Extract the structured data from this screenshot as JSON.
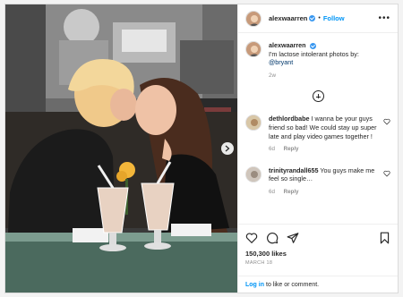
{
  "post": {
    "username": "alexwaarren",
    "follow_label": "Follow",
    "caption_text": "I'm lactose intolerant photos by:",
    "caption_mention": "@bryant",
    "caption_time": "2w",
    "likes": "150,300 likes",
    "date": "MARCH 18",
    "login_link": "Log in",
    "login_text": "to like or comment."
  },
  "comments": [
    {
      "user": "dethlordbabe",
      "text": "I wanna be your guys friend so bad! We could stay up super late and play video games together !",
      "time": "6d",
      "reply": "Reply"
    },
    {
      "user": "trinityrandall655",
      "text": "You guys make me feel so single…",
      "time": "6d",
      "reply": "Reply"
    }
  ],
  "icons": {
    "more": "more-options-icon",
    "load_more": "load-more-comments-icon",
    "like": "heart-icon",
    "comment": "comment-icon",
    "share": "share-icon",
    "save": "bookmark-icon",
    "next": "chevron-right-icon"
  },
  "colors": {
    "accent": "#0095f6",
    "mention": "#00376b",
    "verified": "#3897f0"
  }
}
